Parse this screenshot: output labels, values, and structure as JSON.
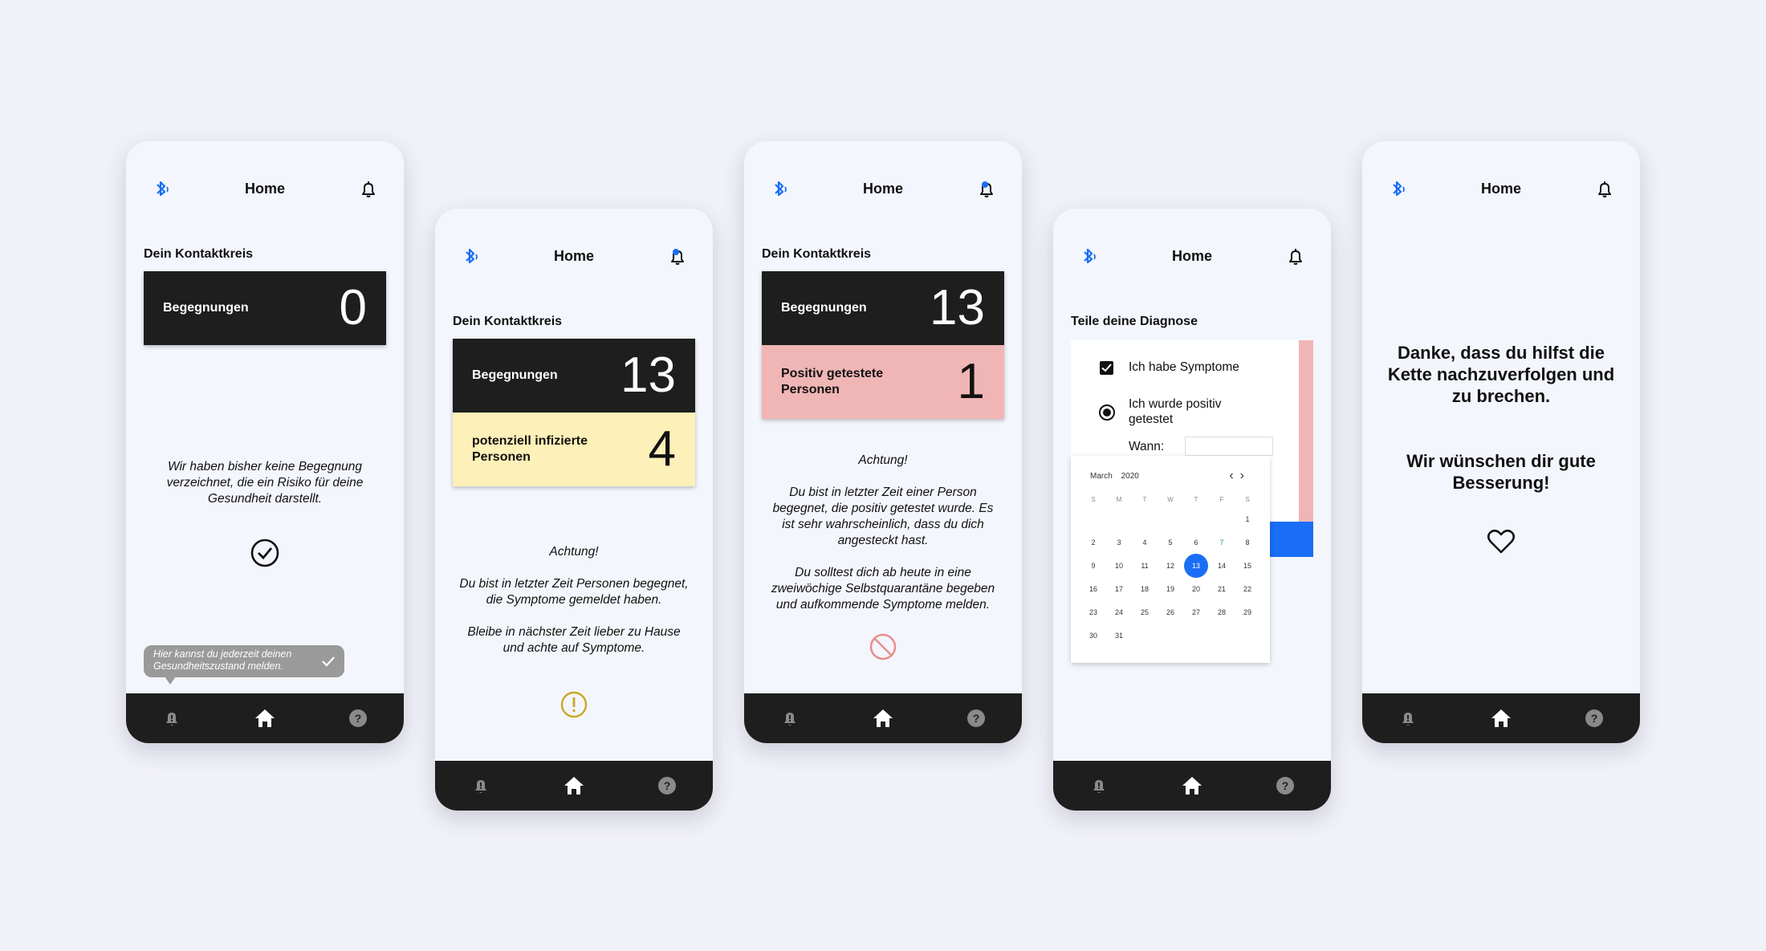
{
  "colors": {
    "accent_blue": "#1a6ef5",
    "card_dark": "#1e1e1e",
    "card_yellow": "#fdf0b8",
    "card_pink": "#f0b5b5",
    "warn_gold": "#c9a824",
    "stop_red": "#e8918f"
  },
  "common": {
    "title": "Home",
    "bluetooth_icon": "bluetooth-icon",
    "bell_icon": "bell-icon"
  },
  "screen1": {
    "section": "Dein Kontaktkreis",
    "card": {
      "label": "Begegnungen",
      "value": "0"
    },
    "message": "Wir haben bisher keine Begegnung verzeichnet, die ein Risiko für deine Gesundheit darstellt.",
    "tooltip": "Hier kannst du jederzeit deinen Gesundheitszustand melden."
  },
  "screen2": {
    "section": "Dein Kontaktkreis",
    "card1": {
      "label": "Begegnungen",
      "value": "13"
    },
    "card2": {
      "label": "potenziell infizierte Personen",
      "value": "4"
    },
    "heading": "Achtung!",
    "p1": "Du bist in letzter Zeit Personen begegnet, die Symptome gemeldet haben.",
    "p2": "Bleibe in nächster Zeit lieber zu Hause und achte auf Symptome."
  },
  "screen3": {
    "section": "Dein Kontaktkreis",
    "card1": {
      "label": "Begegnungen",
      "value": "13"
    },
    "card2": {
      "label": "Positiv getestete Personen",
      "value": "1"
    },
    "heading": "Achtung!",
    "p1": "Du bist in letzter Zeit einer Person begegnet, die positiv getestet wurde. Es ist sehr wahrscheinlich, dass du dich angesteckt hast.",
    "p2": "Du solltest dich ab heute in eine zweiwöchige Selbstquarantäne begeben und aufkommende Symptome melden."
  },
  "screen4": {
    "section": "Teile deine Diagnose",
    "option1": "Ich habe Symptome",
    "option2": "Ich wurde positiv getestet",
    "wann": "Wann:",
    "calendar": {
      "month": "March",
      "year": "2020",
      "weekdays": [
        "S",
        "M",
        "T",
        "W",
        "T",
        "F",
        "S"
      ],
      "weeks": [
        [
          "",
          "",
          "",
          "",
          "",
          "",
          "1"
        ],
        [
          "2",
          "3",
          "4",
          "5",
          "6",
          "7",
          "8"
        ],
        [
          "9",
          "10",
          "11",
          "12",
          "13",
          "14",
          "15"
        ],
        [
          "16",
          "17",
          "18",
          "19",
          "20",
          "21",
          "22"
        ],
        [
          "23",
          "24",
          "25",
          "26",
          "27",
          "28",
          "29"
        ],
        [
          "30",
          "31",
          "",
          "",
          "",
          "",
          ""
        ]
      ],
      "selected": "13",
      "today": "7"
    }
  },
  "screen5": {
    "line1": "Danke, dass du hilfst die Kette nachzuverfolgen und zu brechen.",
    "line2": "Wir wünschen dir gute Besserung!",
    "icon": "heart-icon"
  },
  "navbar": {
    "left": "bell-alert-icon",
    "center": "home-icon",
    "right": "help-icon"
  }
}
